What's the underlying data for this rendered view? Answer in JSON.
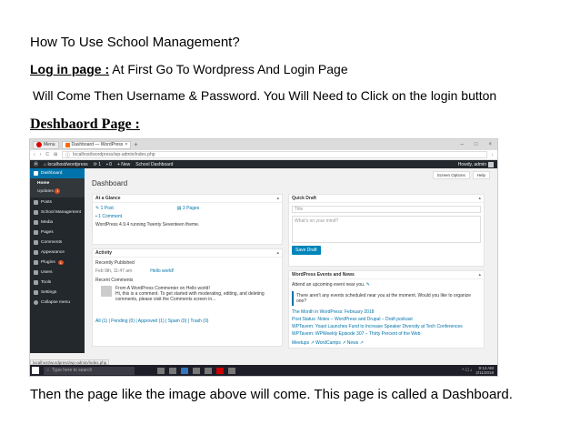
{
  "doc": {
    "title": "How To Use School Management?",
    "login_label": "Log in page :",
    "login_text": " At First Go To Wordpress  And Login Page",
    "will_come": "Will Come Then  Username & Password. You Will Need to Click on the login button",
    "dashboard_heading": "Deshbaord Page :",
    "caption": "Then the page like the image above will come. This page is called a Dashboard."
  },
  "screenshot": {
    "browser": {
      "menu_label": "Menu",
      "tab_title": "Dashboard — WordPress",
      "new_tab": "+",
      "address": "localhost/wordpress/wp-admin/index.php",
      "accent": "#d00000"
    },
    "adminbar": {
      "site": "localhost/wordpress",
      "updates": "1",
      "comments": "0",
      "new": "+ New",
      "school": "School Dashboard",
      "howdy": "Howdy, admin"
    },
    "sidebar": {
      "dashboard": "Dashboard",
      "home": "Home",
      "updates": "Updates",
      "updates_count": "1",
      "posts": "Posts",
      "school": "School Management",
      "media": "Media",
      "pages": "Pages",
      "comments": "Comments",
      "appearance": "Appearance",
      "plugins": "Plugins",
      "plugins_count": "1",
      "users": "Users",
      "tools": "Tools",
      "settings": "Settings",
      "collapse": "Collapse menu"
    },
    "main": {
      "screen_options": "Screen Options",
      "help": "Help",
      "title": "Dashboard",
      "glance": {
        "title": "At a Glance",
        "posts": "1 Post",
        "pages": "3 Pages",
        "comments": "1 Comment",
        "version": "WordPress 4.9.4 running Twenty Seventeen theme."
      },
      "activity": {
        "title": "Activity",
        "recently_published": "Recently Published",
        "date": "Feb 9th, 11:47 am",
        "post": "Hello world!",
        "recent_comments": "Recent Comments",
        "comment_from": "From A WordPress Commenter on Hello world!",
        "comment_body": "Hi, this is a comment. To get started with moderating, editing, and deleting comments, please visit the Comments screen in...",
        "filters": "All (1) | Pending (0) | Approved (1) | Spam (0) | Trash (0)"
      },
      "draft": {
        "title": "Quick Draft",
        "title_placeholder": "Title",
        "body_placeholder": "What's on your mind?",
        "save": "Save Draft"
      },
      "events": {
        "title": "WordPress Events and News",
        "attend": "Attend an upcoming event near you.",
        "notice": "There aren't any events scheduled near you at the moment. Would you like to organize one?",
        "news": [
          "The Month in WordPress: February 2018",
          "Post Status: Notes – WordPress and Drupal – Draft podcast",
          "WPTavern: Yoast Launches Fund to Increase Speaker Diversity at Tech Conferences",
          "WPTavern: WPWeekly Episode 307 – Thirty Percent of the Web"
        ],
        "footer_links": "Meetups ↗   WordCamps ↗   News ↗"
      }
    },
    "status_url": "localhost/wordpress/wp-admin/index.php",
    "taskbar": {
      "search": "Type here to search",
      "time": "9:14 AM",
      "date": "2/11/2018"
    }
  }
}
